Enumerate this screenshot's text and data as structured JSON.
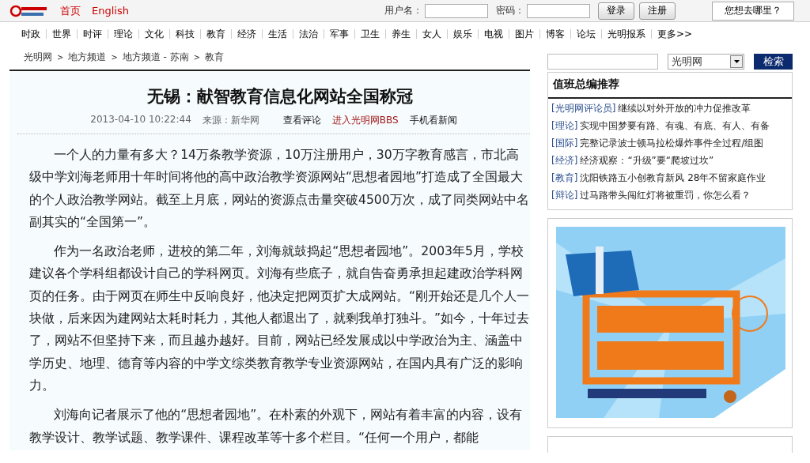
{
  "top_bar": {
    "links": [
      {
        "label": "首页"
      },
      {
        "label": "English"
      }
    ],
    "username_label": "用户名：",
    "password_label": "密码：",
    "buttons": [
      "登录",
      "注册"
    ],
    "where_button": "您想去哪里？"
  },
  "nav": [
    "时政",
    "世界",
    "时评",
    "理论",
    "文化",
    "科技",
    "教育",
    "经济",
    "生活",
    "法治",
    "军事",
    "卫生",
    "养生",
    "女人",
    "娱乐",
    "电视",
    "图片",
    "博客",
    "论坛",
    "光明报系",
    "更多>>"
  ],
  "breadcrumb": {
    "items": [
      "光明网",
      "地方频道",
      "地方频道 - 苏南",
      "教育"
    ],
    "separator": ">"
  },
  "article": {
    "title": "无锡：献智教育信息化网站全国称冠",
    "date": "2013-04-10 10:22:44",
    "source": "来源：新华网",
    "links": [
      {
        "label": "查看评论",
        "highlight": false
      },
      {
        "label": "进入光明网BBS",
        "highlight": true
      },
      {
        "label": "手机看新闻",
        "highlight": false
      }
    ],
    "paragraphs": [
      "一个人的力量有多大？14万条教学资源，10万注册用户，30万字教育感言，市北高级中学刘海老师用十年时间将他的高中政治教学资源网站“思想者园地”打造成了全国最大的个人政治教学网站。截至上月底，网站的资源点击量突破4500万次，成了同类网站中名副其实的“全国第一”。",
      "作为一名政治老师，进校的第二年，刘海就鼓捣起“思想者园地”。2003年5月，学校建议各个学科组都设计自己的学科网页。刘海有些底子，就自告奋勇承担起建政治学科网页的任务。由于网页在师生中反响良好，他决定把网页扩大成网站。“刚开始还是几个人一块做，后来因为建网站太耗时耗力，其他人都退出了，就剩我单打独斗。”如今，十年过去了，网站不但坚持下来，而且越办越好。目前，网站已经发展成以中学政治为主、涵盖中学历史、地理、德育等内容的中学文综类教育教学专业资源网站，在国内具有广泛的影响力。",
      "刘海向记者展示了他的“思想者园地”。在朴素的外观下，网站有着丰富的内容，设有教学设计、教学试题、教学课件、课程改革等十多个栏目。“任何一个用户，都能"
    ]
  },
  "search": {
    "scope": "光明网",
    "button": "检索"
  },
  "recommend": {
    "title": "值班总编推荐",
    "items": [
      {
        "tag": "[光明网评论员]",
        "text": "继续以对外开放的冲力促推改革"
      },
      {
        "tag": "[理论]",
        "text": "实现中国梦要有路、有魂、有底、有人、有备"
      },
      {
        "tag": "[国际]",
        "text": "完整记录波士顿马拉松爆炸事件全过程/组图"
      },
      {
        "tag": "[经济]",
        "text": "经济观察：“升级”要“爬坡过坎”"
      },
      {
        "tag": "[教育]",
        "text": "沈阳铁路五小创教育新风 28年不留家庭作业"
      },
      {
        "tag": "[辩论]",
        "text": "过马路带头闯红灯将被重罚，你怎么看？"
      }
    ]
  }
}
